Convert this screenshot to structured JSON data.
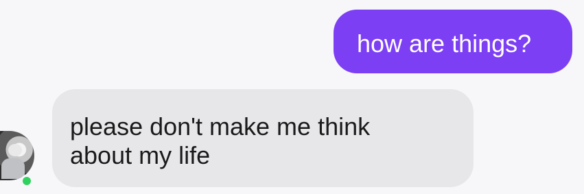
{
  "colors": {
    "outgoing_bubble": "#7d3ff4",
    "incoming_bubble": "#e7e7ea",
    "online_status": "#2fd25f"
  },
  "messages": {
    "outgoing": "how are things?",
    "incoming": [
      "please don't make me think",
      "about my life"
    ]
  },
  "avatar": {
    "icon": "contact-avatar"
  },
  "status": {
    "icon": "online-status-dot"
  }
}
